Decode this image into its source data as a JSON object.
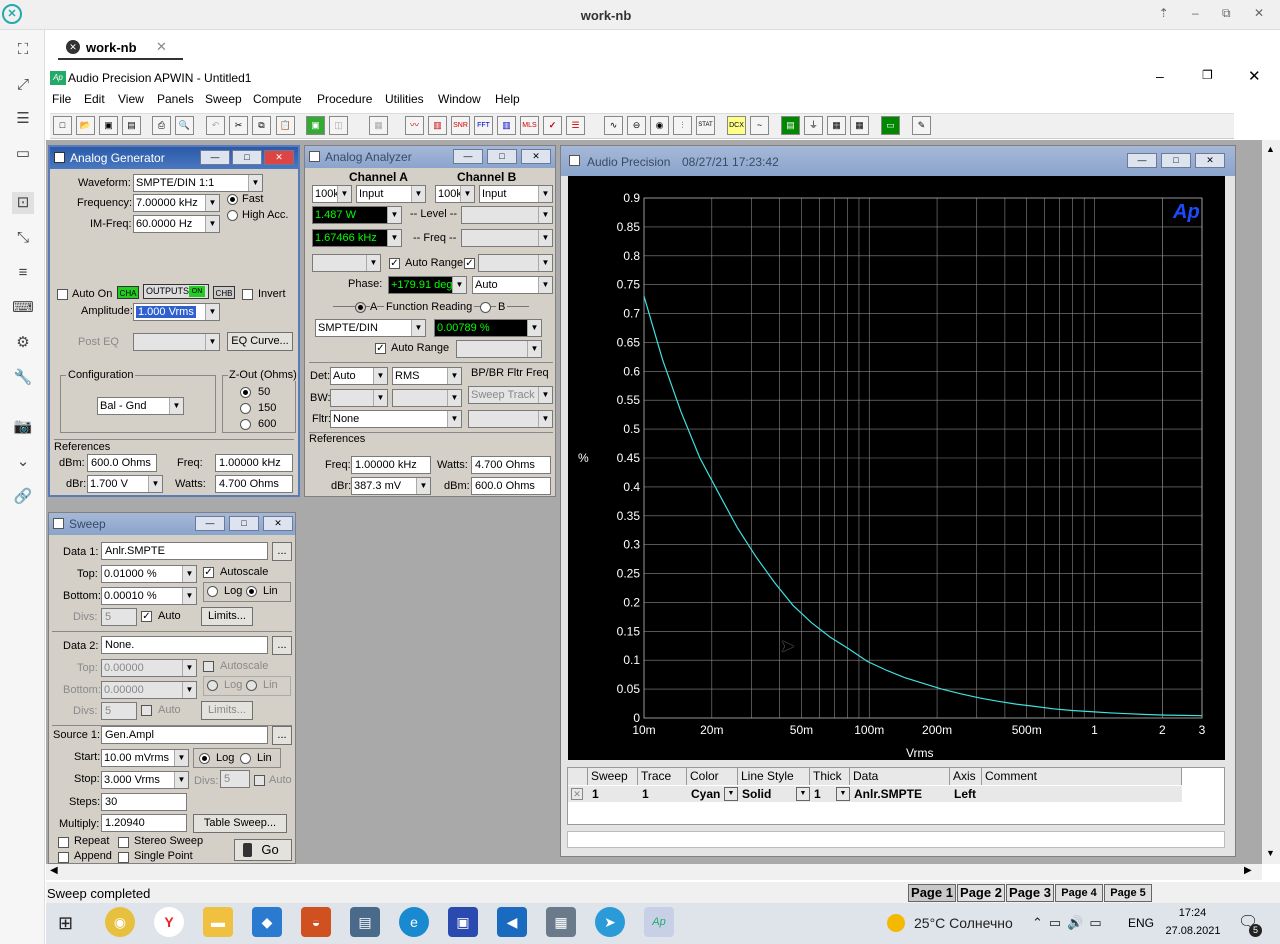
{
  "browser": {
    "title": "work-nb",
    "tab_label": "work-nb"
  },
  "app": {
    "title": "Audio Precision APWIN - Untitled1",
    "menu": [
      "File",
      "Edit",
      "View",
      "Panels",
      "Sweep",
      "Compute",
      "Procedure",
      "Utilities",
      "Window",
      "Help"
    ]
  },
  "generator": {
    "title": "Analog Generator",
    "waveform_label": "Waveform:",
    "waveform": "SMPTE/DIN 1:1",
    "frequency_label": "Frequency:",
    "frequency": "7.00000 kHz",
    "im_freq_label": "IM-Freq:",
    "im_freq": "60.0000  Hz",
    "fast": "Fast",
    "high_acc": "High Acc.",
    "auto_on": "Auto On",
    "cha": "CHA",
    "outputs": "OUTPUTS",
    "on": "ON",
    "chb": "CHB",
    "invert": "Invert",
    "amplitude_label": "Amplitude:",
    "amplitude": "1.000   Vrms",
    "post_eq": "Post EQ",
    "eq_curve": "EQ Curve...",
    "configuration": "Configuration",
    "config_value": "Bal - Gnd",
    "zout_label": "Z-Out (Ohms)",
    "zout": [
      "50",
      "150",
      "600"
    ],
    "references": "References",
    "dbm_label": "dBm:",
    "dbm": "600.0   Ohms",
    "freq_label": "Freq:",
    "freq": "1.00000 kHz",
    "dbr_label": "dBr:",
    "dbr": "1.700   V",
    "watts_label": "Watts:",
    "watts": "4.700   Ohms"
  },
  "analyzer": {
    "title": "Analog Analyzer",
    "channel_a": "Channel A",
    "channel_b": "Channel B",
    "range_a": "100k",
    "input_a": "Input",
    "range_b": "100k",
    "input_b": "Input",
    "level_a": "1.487   W",
    "level_label": "-- Level --",
    "freq_a": "1.67466 kHz",
    "freq_label": "-- Freq --",
    "auto_range": "Auto Range",
    "phase_label": "Phase:",
    "phase": "+179.91  deg",
    "phase_mode": "Auto",
    "a": "A",
    "function_reading": "Function Reading",
    "b": "B",
    "function": "SMPTE/DIN",
    "function_value": "0.00789  %",
    "auto_range2": "Auto Range",
    "det_label": "Det:",
    "det": "Auto",
    "det_mode": "RMS",
    "bpbr": "BP/BR Fltr Freq",
    "bw_label": "BW:",
    "sweep_track": "Sweep Track",
    "fltr_label": "Fltr:",
    "fltr": "None",
    "references": "References",
    "ref_freq_label": "Freq:",
    "ref_freq": "1.00000 kHz",
    "watts_label": "Watts:",
    "watts": "4.700   Ohms",
    "dbr_label": "dBr:",
    "dbr": "387.3   mV",
    "dbm_label": "dBm:",
    "dbm": "600.0   Ohms"
  },
  "sweep": {
    "title": "Sweep",
    "data1_label": "Data 1:",
    "data1": "Anlr.SMPTE",
    "top_label": "Top:",
    "top1": "0.01000  %",
    "autoscale": "Autoscale",
    "bottom_label": "Bottom:",
    "bottom1": "0.00010  %",
    "log": "Log",
    "lin": "Lin",
    "divs_label": "Divs:",
    "divs": "5",
    "auto": "Auto",
    "limits": "Limits...",
    "data2_label": "Data 2:",
    "data2": "None.",
    "top2": "0.00000",
    "bottom2": "0.00000",
    "source1_label": "Source 1:",
    "source1": "Gen.Ampl",
    "start_label": "Start:",
    "start": "10.00  mVrms",
    "stop_label": "Stop:",
    "stop": "3.000   Vrms",
    "divs_src": "5",
    "steps_label": "Steps:",
    "steps": "30",
    "multiply_label": "Multiply:",
    "multiply": "1.20940",
    "table_sweep": "Table Sweep...",
    "repeat": "Repeat",
    "stereo_sweep": "Stereo Sweep",
    "append": "Append",
    "single_point": "Single Point",
    "go": "Go",
    "ellipsis": "..."
  },
  "graph_window": {
    "title": "Audio Precision",
    "timestamp": "08/27/21 17:23:42"
  },
  "chart_data": {
    "type": "line",
    "ylabel": "%",
    "xlabel": "Vrms",
    "x_scale": "log",
    "xlim": [
      0.01,
      3
    ],
    "ylim": [
      0,
      0.9
    ],
    "grid": true,
    "background": "#000000",
    "line_color": "#40e0e0",
    "logo": "Ap",
    "x_ticks": [
      0.01,
      0.02,
      0.05,
      0.1,
      0.2,
      0.5,
      1,
      2,
      3
    ],
    "x_tick_labels": [
      "10m",
      "20m",
      "50m",
      "100m",
      "200m",
      "500m",
      "1",
      "2",
      "3"
    ],
    "y_ticks": [
      0,
      0.05,
      0.1,
      0.15,
      0.2,
      0.25,
      0.3,
      0.35,
      0.4,
      0.45,
      0.5,
      0.55,
      0.6,
      0.65,
      0.7,
      0.75,
      0.8,
      0.85,
      0.9
    ],
    "y_tick_labels": [
      "0",
      "0.05",
      "0.1",
      "0.15",
      "0.2",
      "0.25",
      "0.3",
      "0.35",
      "0.4",
      "0.45",
      "0.5",
      "0.55",
      "0.6",
      "0.65",
      "0.7",
      "0.75",
      "0.8",
      "0.85",
      "0.9"
    ],
    "series": [
      {
        "x": [
          0.01,
          0.0121,
          0.0146,
          0.0177,
          0.0214,
          0.0259,
          0.0313,
          0.0379,
          0.0458,
          0.0554,
          0.067,
          0.081,
          0.098,
          0.1185,
          0.1434,
          0.1734,
          0.2097,
          0.2536,
          0.3067,
          0.3709,
          0.4486,
          0.5426,
          0.6563,
          0.7937,
          0.96,
          1.16,
          1.4,
          1.7,
          2.06,
          2.49,
          3.0
        ],
        "y": [
          0.73,
          0.62,
          0.53,
          0.45,
          0.39,
          0.33,
          0.28,
          0.235,
          0.195,
          0.165,
          0.14,
          0.12,
          0.098,
          0.083,
          0.07,
          0.06,
          0.05,
          0.042,
          0.035,
          0.029,
          0.024,
          0.02,
          0.016,
          0.013,
          0.011,
          0.009,
          0.0075,
          0.006,
          0.005,
          0.0045,
          0.004
        ]
      }
    ]
  },
  "trace_table": {
    "headers": [
      "Sweep",
      "Trace",
      "Color",
      "Line Style",
      "Thick",
      "Data",
      "Axis",
      "Comment"
    ],
    "row": {
      "sweep": "1",
      "trace": "1",
      "color": "Cyan",
      "style": "Solid",
      "thick": "1",
      "data": "Anlr.SMPTE",
      "axis": "Left",
      "comment": ""
    }
  },
  "status": {
    "text": "Sweep completed"
  },
  "pages": [
    "Page 1",
    "Page 2",
    "Page 3",
    "Page 4",
    "Page 5"
  ],
  "taskbar": {
    "weather": "25°C  Солнечно",
    "lang": "ENG",
    "time": "17:24",
    "date": "27.08.2021",
    "notif": "5"
  },
  "toolbar_icons": [
    "new-file",
    "open",
    "save",
    "save-all",
    "print",
    "print-preview",
    "undo",
    "cut",
    "copy",
    "paste",
    "go",
    "stop",
    "panels",
    "graph",
    "analyzer",
    "snr",
    "fft",
    "spectrum",
    "mls",
    "check",
    "list",
    "sine",
    "scope",
    "meter",
    "sweep-bars",
    "stat",
    "dcx",
    "tilde",
    "green-bars",
    "probe",
    "table",
    "grid",
    "monitor",
    "notes"
  ]
}
